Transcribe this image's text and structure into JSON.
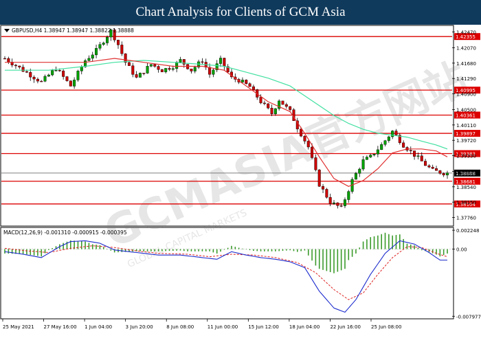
{
  "header": {
    "title": "Chart Analysis for Clients of GCM Asia"
  },
  "watermark": {
    "text": "GCMASIA官方网站",
    "sub": "GLOBAL CAPITAL MARKETS"
  },
  "chart_data": [
    {
      "type": "candlestick",
      "info_label": "GBPUSD,H4  1.38947 1.38947 1.38822 1.38888",
      "ylim": [
        1.3756,
        1.4262
      ],
      "y_ticks": [
        "1.42470",
        "1.42070",
        "1.41680",
        "1.41290",
        "1.40900",
        "1.40500",
        "1.40110",
        "1.39720",
        "1.39330",
        "1.38930",
        "1.38540",
        "1.38150",
        "1.37760"
      ],
      "x_labels": [
        "25 May 2021",
        "27 May 16:00",
        "1 Jun 04:00",
        "3 Jun 20:00",
        "8 Jun 08:00",
        "11 Jun 00:00",
        "15 Jun 12:00",
        "18 Jun 04:00",
        "22 Jun 16:00",
        "25 Jun 08:00"
      ],
      "current_price": {
        "value": 1.38888,
        "label": "1.38888"
      },
      "levels": [
        {
          "value": 1.42355,
          "label": "1.42355"
        },
        {
          "value": 1.40995,
          "label": "1.40995"
        },
        {
          "value": 1.40361,
          "label": "1.40361"
        },
        {
          "value": 1.39897,
          "label": "1.39897"
        },
        {
          "value": 1.39383,
          "label": "1.39383"
        },
        {
          "value": 1.38681,
          "label": "1.38681"
        },
        {
          "value": 1.38104,
          "label": "1.38104"
        }
      ],
      "colors": {
        "up": "#00a000",
        "down": "#cc0000",
        "level": "#dd0000",
        "ma_fast": "#e03030",
        "ma_slow": "#40e0a0"
      },
      "close_path": [
        [
          0,
          1.418
        ],
        [
          5,
          1.415
        ],
        [
          10,
          1.412
        ],
        [
          14,
          1.4155
        ],
        [
          18,
          1.411
        ],
        [
          22,
          1.4175
        ],
        [
          25,
          1.42
        ],
        [
          29,
          1.425
        ],
        [
          31,
          1.4215
        ],
        [
          33,
          1.417
        ],
        [
          36,
          1.413
        ],
        [
          40,
          1.4165
        ],
        [
          43,
          1.415
        ],
        [
          46,
          1.416
        ],
        [
          48,
          1.4175
        ],
        [
          51,
          1.415
        ],
        [
          54,
          1.4175
        ],
        [
          56,
          1.414
        ],
        [
          59,
          1.4175
        ],
        [
          62,
          1.413
        ],
        [
          64,
          1.4125
        ],
        [
          67,
          1.4108
        ],
        [
          70,
          1.407
        ],
        [
          73,
          1.404
        ],
        [
          75,
          1.4075
        ],
        [
          78,
          1.4045
        ],
        [
          80,
          1.4005
        ],
        [
          83,
          1.3955
        ],
        [
          86,
          1.386
        ],
        [
          89,
          1.3815
        ],
        [
          92,
          1.38
        ],
        [
          95,
          1.387
        ],
        [
          98,
          1.392
        ],
        [
          100,
          1.393
        ],
        [
          103,
          1.396
        ],
        [
          106,
          1.3995
        ],
        [
          109,
          1.396
        ],
        [
          112,
          1.3935
        ],
        [
          115,
          1.391
        ],
        [
          117,
          1.3895
        ],
        [
          120,
          1.3889
        ]
      ],
      "ma_fast": [
        [
          0,
          1.417
        ],
        [
          12,
          1.417
        ],
        [
          22,
          1.417
        ],
        [
          30,
          1.418
        ],
        [
          38,
          1.417
        ],
        [
          46,
          1.416
        ],
        [
          54,
          1.416
        ],
        [
          60,
          1.415
        ],
        [
          66,
          1.411
        ],
        [
          72,
          1.407
        ],
        [
          78,
          1.4045
        ],
        [
          82,
          1.399
        ],
        [
          86,
          1.393
        ],
        [
          90,
          1.3875
        ],
        [
          94,
          1.3855
        ],
        [
          98,
          1.387
        ],
        [
          102,
          1.39
        ],
        [
          106,
          1.394
        ],
        [
          110,
          1.395
        ],
        [
          114,
          1.395
        ],
        [
          118,
          1.3945
        ],
        [
          121,
          1.393
        ]
      ],
      "ma_slow": [
        [
          0,
          1.415
        ],
        [
          12,
          1.415
        ],
        [
          22,
          1.416
        ],
        [
          30,
          1.417
        ],
        [
          38,
          1.4175
        ],
        [
          46,
          1.417
        ],
        [
          54,
          1.4165
        ],
        [
          60,
          1.416
        ],
        [
          66,
          1.4145
        ],
        [
          72,
          1.413
        ],
        [
          78,
          1.411
        ],
        [
          82,
          1.4085
        ],
        [
          86,
          1.406
        ],
        [
          90,
          1.4035
        ],
        [
          94,
          1.4015
        ],
        [
          98,
          1.4
        ],
        [
          102,
          1.399
        ],
        [
          106,
          1.3985
        ],
        [
          110,
          1.398
        ],
        [
          114,
          1.397
        ],
        [
          118,
          1.396
        ],
        [
          121,
          1.395
        ]
      ],
      "n_bars": 122
    },
    {
      "type": "macd",
      "label": "MACD(12,26,9) -0.001310 -0.000915 -0.000395",
      "ylim": [
        -0.0082,
        0.0025
      ],
      "y_ticks": [
        "0.002248",
        "0.00",
        "-0.007977"
      ],
      "colors": {
        "histogram": "#3a9a2a",
        "signal": "#dd2020",
        "main": "#1a2acc"
      },
      "macd_path": [
        [
          0,
          -0.0003
        ],
        [
          5,
          -0.0006
        ],
        [
          10,
          -0.001
        ],
        [
          15,
          0.0003
        ],
        [
          18,
          0.0009
        ],
        [
          22,
          0.001
        ],
        [
          26,
          0.0007
        ],
        [
          30,
          -0.0001
        ],
        [
          36,
          -0.0004
        ],
        [
          42,
          -0.0007
        ],
        [
          48,
          -0.0007
        ],
        [
          54,
          -0.001
        ],
        [
          58,
          -0.0012
        ],
        [
          62,
          -0.0003
        ],
        [
          66,
          -0.0007
        ],
        [
          70,
          -0.001
        ],
        [
          74,
          -0.0012
        ],
        [
          78,
          -0.0015
        ],
        [
          82,
          -0.0022
        ],
        [
          86,
          -0.005
        ],
        [
          90,
          -0.007
        ],
        [
          93,
          -0.0075
        ],
        [
          96,
          -0.006
        ],
        [
          100,
          -0.003
        ],
        [
          104,
          -0.0005
        ],
        [
          108,
          0.001
        ],
        [
          112,
          0.0006
        ],
        [
          116,
          -0.0004
        ],
        [
          119,
          -0.0013
        ],
        [
          121,
          -0.0013
        ]
      ],
      "signal_path": [
        [
          0,
          0.0001
        ],
        [
          6,
          -0.0002
        ],
        [
          12,
          -0.0004
        ],
        [
          18,
          0.0001
        ],
        [
          24,
          0.0004
        ],
        [
          30,
          0.0002
        ],
        [
          36,
          -0.0002
        ],
        [
          42,
          -0.0005
        ],
        [
          50,
          -0.0006
        ],
        [
          56,
          -0.0009
        ],
        [
          62,
          -0.0006
        ],
        [
          68,
          -0.0007
        ],
        [
          74,
          -0.001
        ],
        [
          80,
          -0.0016
        ],
        [
          85,
          -0.0028
        ],
        [
          90,
          -0.0048
        ],
        [
          94,
          -0.006
        ],
        [
          98,
          -0.0052
        ],
        [
          102,
          -0.003
        ],
        [
          106,
          -0.001
        ],
        [
          110,
          0.0003
        ],
        [
          114,
          0.0002
        ],
        [
          118,
          -0.0005
        ],
        [
          121,
          -0.0009
        ]
      ]
    }
  ]
}
